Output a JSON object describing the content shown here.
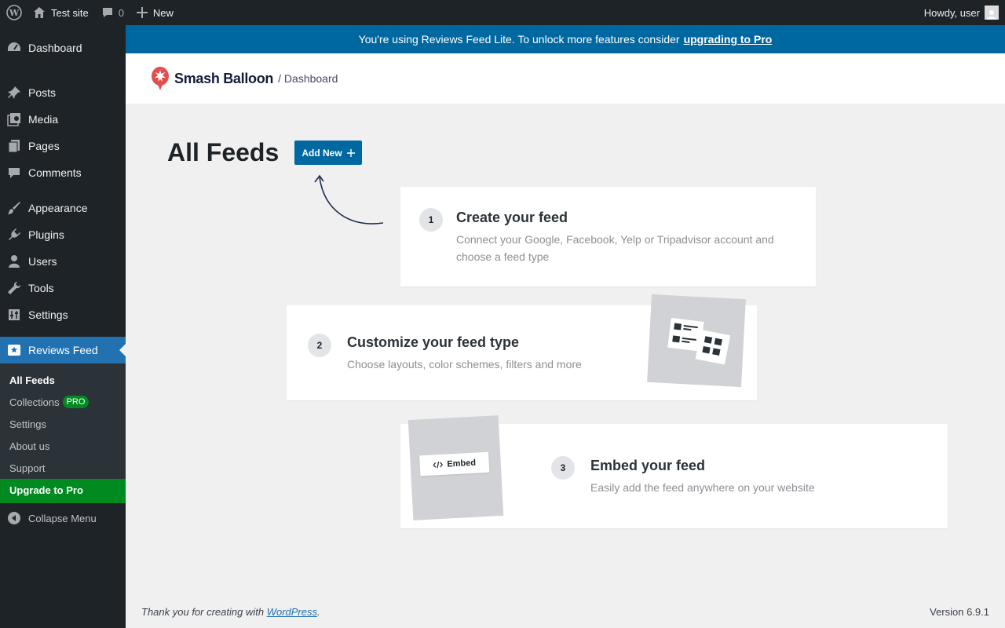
{
  "adminbar": {
    "site_name": "Test site",
    "comments_count": "0",
    "new_label": "New",
    "greeting": "Howdy, user"
  },
  "sidebar": {
    "items": [
      {
        "label": "Dashboard",
        "icon": "dashboard-icon"
      },
      {
        "label": "Posts",
        "icon": "pushpin-icon"
      },
      {
        "label": "Media",
        "icon": "media-icon"
      },
      {
        "label": "Pages",
        "icon": "pages-icon"
      },
      {
        "label": "Comments",
        "icon": "comment-icon"
      },
      {
        "label": "Appearance",
        "icon": "paintbrush-icon"
      },
      {
        "label": "Plugins",
        "icon": "plugin-icon"
      },
      {
        "label": "Users",
        "icon": "user-icon"
      },
      {
        "label": "Tools",
        "icon": "wrench-icon"
      },
      {
        "label": "Settings",
        "icon": "settings-icon"
      },
      {
        "label": "Reviews Feed",
        "icon": "reviews-icon"
      }
    ],
    "submenu": {
      "all_feeds": "All Feeds",
      "collections": "Collections",
      "pro_badge": "PRO",
      "settings": "Settings",
      "about": "About us",
      "support": "Support",
      "upgrade": "Upgrade to Pro"
    },
    "collapse": "Collapse Menu"
  },
  "notice": {
    "text": "You're using Reviews Feed Lite. To unlock more features consider",
    "link": "upgrading to Pro"
  },
  "brand": {
    "name": "Smash Balloon",
    "crumb": "/ Dashboard"
  },
  "main": {
    "title": "All Feeds",
    "add_new": "Add New",
    "steps": [
      {
        "num": "1",
        "title": "Create your feed",
        "desc": "Connect your Google, Facebook, Yelp or Tripadvisor account and choose a feed type"
      },
      {
        "num": "2",
        "title": "Customize your feed type",
        "desc": "Choose layouts, color schemes, filters and more"
      },
      {
        "num": "3",
        "title": "Embed your feed",
        "desc": "Easily add the feed anywhere on your website"
      }
    ],
    "embed_chip": "Embed"
  },
  "footer": {
    "thanks": "Thank you for creating with",
    "wp_link": "WordPress",
    "version": "Version 6.9.1"
  },
  "colors": {
    "notice_bg": "#0068a0",
    "active_menu": "#2271b1",
    "upgrade_green": "#008a20",
    "brand_red": "#e34f4f"
  }
}
